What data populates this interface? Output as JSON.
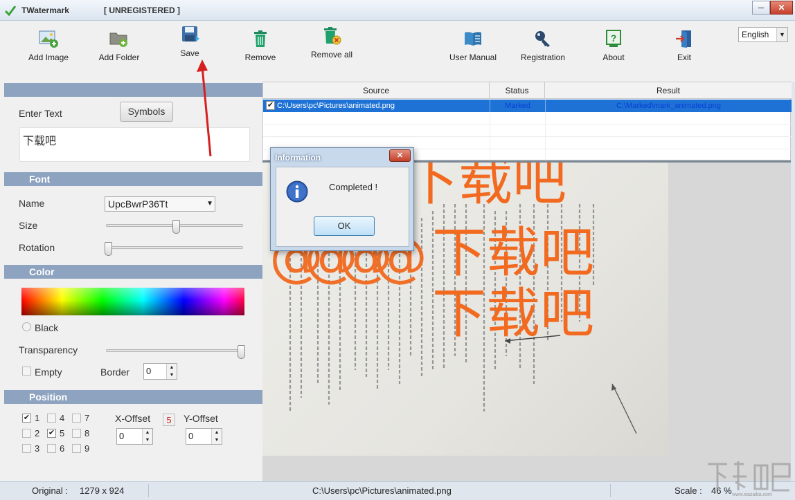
{
  "window": {
    "app_name": "TWatermark",
    "registration_state": "[ UNREGISTERED ]",
    "minimize_glyph": "─",
    "close_glyph": "✕"
  },
  "toolbar": {
    "add_image": "Add Image",
    "add_folder": "Add Folder",
    "save": "Save",
    "remove": "Remove",
    "remove_all": "Remove all",
    "user_manual": "User Manual",
    "registration": "Registration",
    "about": "About",
    "exit": "Exit",
    "language": "English"
  },
  "text_section": {
    "label": "Enter Text",
    "symbols_button": "Symbols",
    "value": "下载吧"
  },
  "font_section": {
    "title": "Font",
    "name_label": "Name",
    "name_value": "UpcBwrP36Tt",
    "size_label": "Size",
    "size_level": 0.51,
    "rotation_label": "Rotation",
    "rotation_level": 0.0
  },
  "color_section": {
    "title": "Color",
    "black_label": "Black",
    "transparency_label": "Transparency",
    "transparency_level": 1.0,
    "empty_label": "Empty",
    "border_label": "Border",
    "border_value": "0"
  },
  "position_section": {
    "title": "Position",
    "positions": [
      {
        "label": "1",
        "checked": true
      },
      {
        "label": "4",
        "checked": false
      },
      {
        "label": "7",
        "checked": false
      },
      {
        "label": "2",
        "checked": false
      },
      {
        "label": "5",
        "checked": true
      },
      {
        "label": "8",
        "checked": false
      },
      {
        "label": "3",
        "checked": false
      },
      {
        "label": "6",
        "checked": false
      },
      {
        "label": "9",
        "checked": false
      }
    ],
    "x_offset_label": "X-Offset",
    "x_offset_value": "0",
    "selected_number": "5",
    "y_offset_label": "Y-Offset",
    "y_offset_value": "0"
  },
  "file_table": {
    "columns": [
      "Source",
      "Status",
      "Result"
    ],
    "rows": [
      {
        "source": "C:\\Users\\pc\\Pictures\\animated.png",
        "status": "Marked",
        "result": "C:\\Marked\\mark_animated.png",
        "checked": true
      }
    ]
  },
  "preview": {
    "watermark_text": "下载吧"
  },
  "dialog": {
    "title": "Information",
    "message": "Completed !",
    "ok_button": "OK",
    "close_glyph": "✕"
  },
  "statusbar": {
    "original_label": "Original :",
    "original_value": "1279 x 924",
    "path": "C:\\Users\\pc\\Pictures\\animated.png",
    "scale_label": "Scale :",
    "scale_value": "46 %"
  },
  "colors": {
    "accent": "#1e72d6",
    "section_header": "#8da3bf",
    "watermark": "#f26a1f",
    "annotation_arrow": "#d61f1f"
  }
}
